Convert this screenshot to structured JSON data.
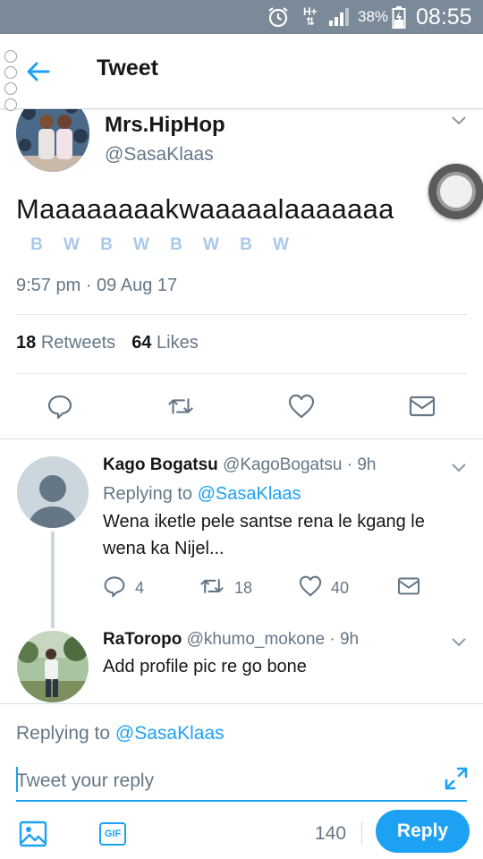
{
  "status_bar": {
    "network": "H+",
    "battery_percent": "38%",
    "time": "08:55",
    "icons": [
      "alarm-icon",
      "network-icon",
      "signal-icon",
      "battery-charging-icon"
    ]
  },
  "app_bar": {
    "title": "Tweet",
    "back_icon": "back-arrow-icon"
  },
  "tweet": {
    "author_name": "Mrs.HipHop",
    "author_handle": "@SasaKlaas",
    "text": "Maaaaaaaakwaaaaalaaaaaaa",
    "emoji": [
      "B",
      "W",
      "B",
      "W",
      "B",
      "W",
      "B",
      "W"
    ],
    "timestamp": "9:57 pm · 09 Aug 17",
    "retweets_count": "18",
    "retweets_label": "Retweets",
    "likes_count": "64",
    "likes_label": "Likes",
    "actions": [
      "reply-icon",
      "retweet-icon",
      "like-icon",
      "share-mail-icon"
    ]
  },
  "replies": [
    {
      "name": "Kago Bogatsu",
      "handle": "@KagoBogatsu",
      "age": "· 9h",
      "replying_label": "Replying to",
      "replying_to": "@SasaKlaas",
      "text": "Wena iketle pele santse rena le kgang le wena ka Nijel...",
      "reply_count": "4",
      "retweet_count": "18",
      "like_count": "40"
    },
    {
      "name": "RaToropo",
      "handle": "@khumo_mokone",
      "age": "· 9h",
      "text": "Add profile pic re go bone"
    }
  ],
  "compose": {
    "replying_label": "Replying to",
    "replying_to": "@SasaKlaas",
    "placeholder": "Tweet your reply",
    "gif_label": "GIF",
    "char_count": "140",
    "reply_button": "Reply"
  },
  "colors": {
    "accent": "#1da1f2",
    "secondary_text": "#657786",
    "status_bar": "#7b8a99"
  }
}
